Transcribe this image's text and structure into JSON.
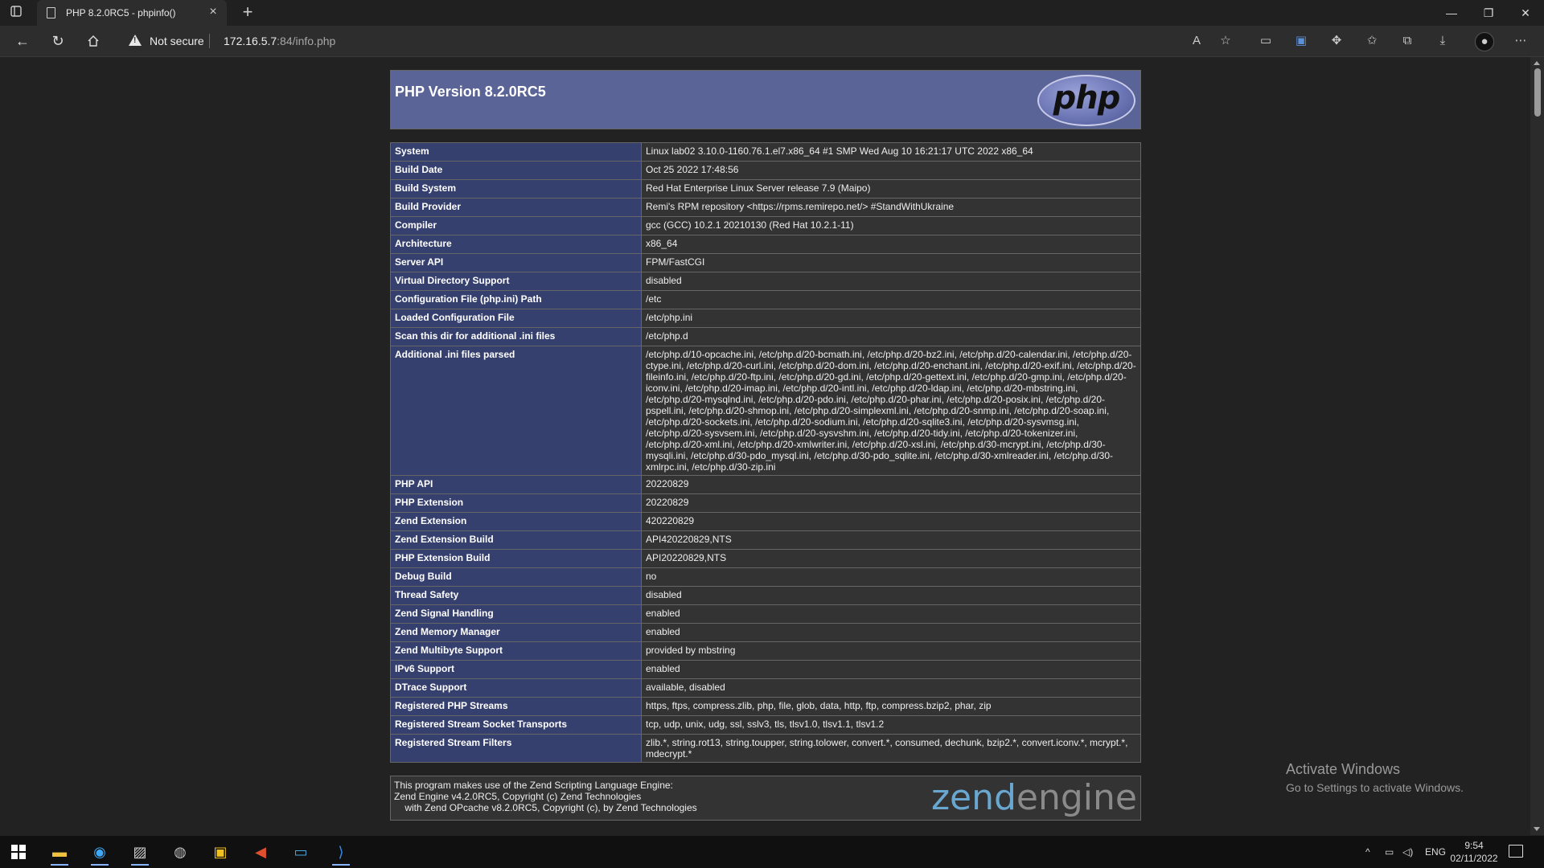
{
  "browser": {
    "tab_title": "PHP 8.2.0RC5 - phpinfo()",
    "security_label": "Not secure",
    "url_host": "172.16.5.7",
    "url_rest": ":84/info.php"
  },
  "page": {
    "header_title": "PHP Version 8.2.0RC5",
    "logo_text": "php",
    "rows": [
      {
        "key": "System",
        "value": "Linux lab02 3.10.0-1160.76.1.el7.x86_64 #1 SMP Wed Aug 10 16:21:17 UTC 2022 x86_64"
      },
      {
        "key": "Build Date",
        "value": "Oct 25 2022 17:48:56"
      },
      {
        "key": "Build System",
        "value": "Red Hat Enterprise Linux Server release 7.9 (Maipo)"
      },
      {
        "key": "Build Provider",
        "value": "Remi's RPM repository <https://rpms.remirepo.net/> #StandWithUkraine"
      },
      {
        "key": "Compiler",
        "value": "gcc (GCC) 10.2.1 20210130 (Red Hat 10.2.1-11)"
      },
      {
        "key": "Architecture",
        "value": "x86_64"
      },
      {
        "key": "Server API",
        "value": "FPM/FastCGI"
      },
      {
        "key": "Virtual Directory Support",
        "value": "disabled"
      },
      {
        "key": "Configuration File (php.ini) Path",
        "value": "/etc"
      },
      {
        "key": "Loaded Configuration File",
        "value": "/etc/php.ini"
      },
      {
        "key": "Scan this dir for additional .ini files",
        "value": "/etc/php.d"
      },
      {
        "key": "Additional .ini files parsed",
        "value": "/etc/php.d/10-opcache.ini, /etc/php.d/20-bcmath.ini, /etc/php.d/20-bz2.ini, /etc/php.d/20-calendar.ini, /etc/php.d/20-ctype.ini, /etc/php.d/20-curl.ini, /etc/php.d/20-dom.ini, /etc/php.d/20-enchant.ini, /etc/php.d/20-exif.ini, /etc/php.d/20-fileinfo.ini, /etc/php.d/20-ftp.ini, /etc/php.d/20-gd.ini, /etc/php.d/20-gettext.ini, /etc/php.d/20-gmp.ini, /etc/php.d/20-iconv.ini, /etc/php.d/20-imap.ini, /etc/php.d/20-intl.ini, /etc/php.d/20-ldap.ini, /etc/php.d/20-mbstring.ini, /etc/php.d/20-mysqlnd.ini, /etc/php.d/20-pdo.ini, /etc/php.d/20-phar.ini, /etc/php.d/20-posix.ini, /etc/php.d/20-pspell.ini, /etc/php.d/20-shmop.ini, /etc/php.d/20-simplexml.ini, /etc/php.d/20-snmp.ini, /etc/php.d/20-soap.ini, /etc/php.d/20-sockets.ini, /etc/php.d/20-sodium.ini, /etc/php.d/20-sqlite3.ini, /etc/php.d/20-sysvmsg.ini, /etc/php.d/20-sysvsem.ini, /etc/php.d/20-sysvshm.ini, /etc/php.d/20-tidy.ini, /etc/php.d/20-tokenizer.ini, /etc/php.d/20-xml.ini, /etc/php.d/20-xmlwriter.ini, /etc/php.d/20-xsl.ini, /etc/php.d/30-mcrypt.ini, /etc/php.d/30-mysqli.ini, /etc/php.d/30-pdo_mysql.ini, /etc/php.d/30-pdo_sqlite.ini, /etc/php.d/30-xmlreader.ini, /etc/php.d/30-xmlrpc.ini, /etc/php.d/30-zip.ini"
      },
      {
        "key": "PHP API",
        "value": "20220829"
      },
      {
        "key": "PHP Extension",
        "value": "20220829"
      },
      {
        "key": "Zend Extension",
        "value": "420220829"
      },
      {
        "key": "Zend Extension Build",
        "value": "API420220829,NTS"
      },
      {
        "key": "PHP Extension Build",
        "value": "API20220829,NTS"
      },
      {
        "key": "Debug Build",
        "value": "no"
      },
      {
        "key": "Thread Safety",
        "value": "disabled"
      },
      {
        "key": "Zend Signal Handling",
        "value": "enabled"
      },
      {
        "key": "Zend Memory Manager",
        "value": "enabled"
      },
      {
        "key": "Zend Multibyte Support",
        "value": "provided by mbstring"
      },
      {
        "key": "IPv6 Support",
        "value": "enabled"
      },
      {
        "key": "DTrace Support",
        "value": "available, disabled"
      },
      {
        "key": "Registered PHP Streams",
        "value": "https, ftps, compress.zlib, php, file, glob, data, http, ftp, compress.bzip2, phar, zip"
      },
      {
        "key": "Registered Stream Socket Transports",
        "value": "tcp, udp, unix, udg, ssl, sslv3, tls, tlsv1.0, tlsv1.1, tlsv1.2"
      },
      {
        "key": "Registered Stream Filters",
        "value": "zlib.*, string.rot13, string.toupper, string.tolower, convert.*, consumed, dechunk, bzip2.*, convert.iconv.*, mcrypt.*, mdecrypt.*"
      }
    ],
    "footer_lines": [
      "This program makes use of the Zend Scripting Language Engine:",
      "Zend Engine v4.2.0RC5, Copyright (c) Zend Technologies",
      "    with Zend OPcache v8.2.0RC5, Copyright (c), by Zend Technologies"
    ],
    "zend_logo_part1": "zend",
    "zend_logo_part2": "engine"
  },
  "watermark": {
    "line1": "Activate Windows",
    "line2": "Go to Settings to activate Windows."
  },
  "taskbar": {
    "language": "ENG",
    "time": "9:54",
    "date": "02/11/2022"
  }
}
